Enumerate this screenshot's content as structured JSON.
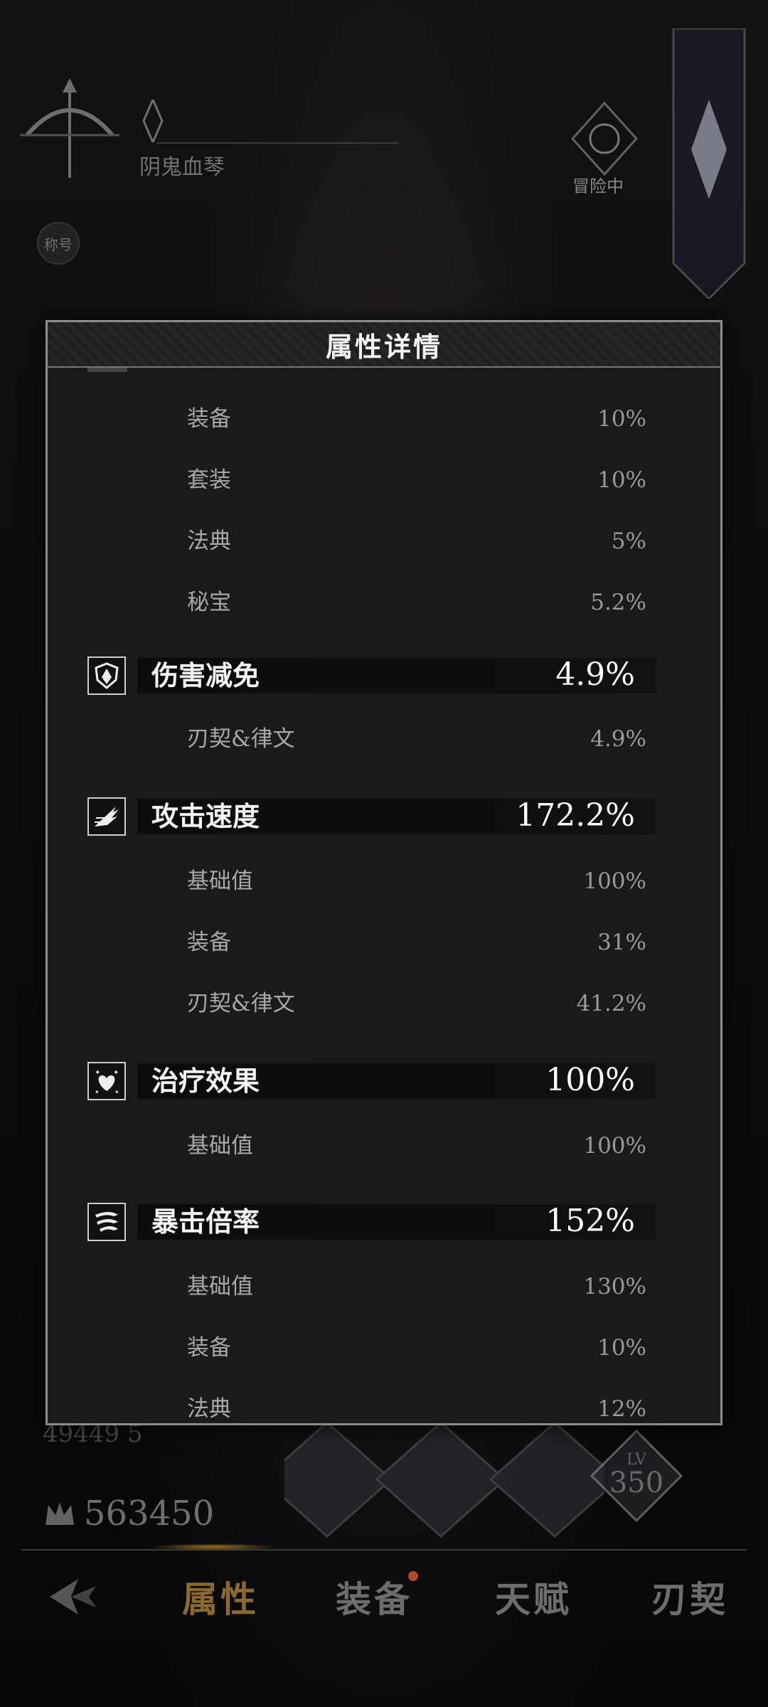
{
  "background": {
    "player_title": "阴鬼血琴",
    "badge_text": "称号",
    "adventure_label": "冒险中",
    "power_value_1": "49449 5",
    "power_value_2": "563450",
    "level_label": "LV",
    "level_value": "350",
    "nav": {
      "tabs": [
        {
          "label": "属性",
          "active": true
        },
        {
          "label": "装备",
          "active": false,
          "has_notification": true
        },
        {
          "label": "天赋",
          "active": false
        },
        {
          "label": "刃契",
          "active": false
        }
      ]
    }
  },
  "modal": {
    "title": "属性详情",
    "sections": [
      {
        "header": null,
        "rows": [
          {
            "label": "装备",
            "value": "10%"
          },
          {
            "label": "套装",
            "value": "10%"
          },
          {
            "label": "法典",
            "value": "5%"
          },
          {
            "label": "秘宝",
            "value": "5.2%"
          }
        ]
      },
      {
        "header": {
          "name": "伤害减免",
          "value": "4.9%",
          "icon": "shield-icon"
        },
        "rows": [
          {
            "label": "刃契&律文",
            "value": "4.9%"
          }
        ]
      },
      {
        "header": {
          "name": "攻击速度",
          "value": "172.2%",
          "icon": "wing-speed-icon"
        },
        "rows": [
          {
            "label": "基础值",
            "value": "100%"
          },
          {
            "label": "装备",
            "value": "31%"
          },
          {
            "label": "刃契&律文",
            "value": "41.2%"
          }
        ]
      },
      {
        "header": {
          "name": "治疗效果",
          "value": "100%",
          "icon": "heart-sparkle-icon"
        },
        "rows": [
          {
            "label": "基础值",
            "value": "100%"
          }
        ]
      },
      {
        "header": {
          "name": "暴击倍率",
          "value": "152%",
          "icon": "claw-slash-icon"
        },
        "rows": [
          {
            "label": "基础值",
            "value": "130%"
          },
          {
            "label": "装备",
            "value": "10%"
          },
          {
            "label": "法典",
            "value": "12%"
          }
        ]
      }
    ]
  }
}
